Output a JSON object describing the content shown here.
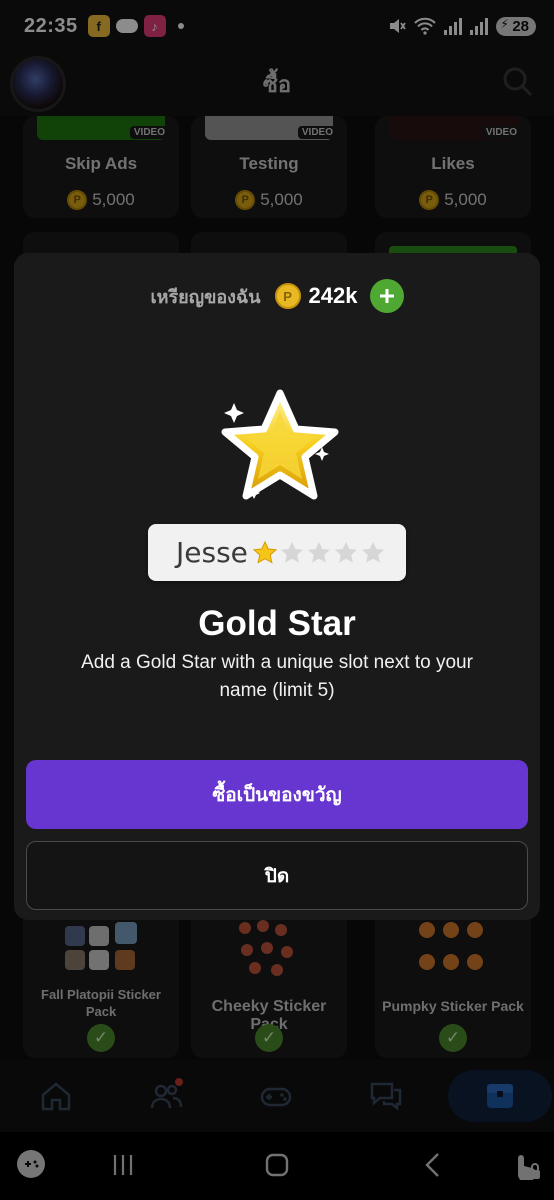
{
  "status_bar": {
    "time": "22:35",
    "battery": "28",
    "icons": [
      "f-app-icon",
      "cloud-icon",
      "music-app-icon",
      "dot-icon",
      "mute-icon",
      "wifi-icon",
      "signal-icon",
      "signal-icon",
      "battery-icon"
    ]
  },
  "header": {
    "title": "ซื้อ",
    "icons": [
      "avatar",
      "search-icon"
    ]
  },
  "background_cards": [
    {
      "label": "Skip Ads",
      "price": "5,000",
      "tag": "VIDEO"
    },
    {
      "label": "Testing",
      "price": "5,000",
      "tag": "VIDEO"
    },
    {
      "label": "Likes",
      "price": "5,000",
      "tag": "VIDEO"
    },
    {
      "label": "Fall Platopii Sticker Pack"
    },
    {
      "label": "Cheeky Sticker Pack"
    },
    {
      "label": "Pumpky Sticker Pack"
    }
  ],
  "modal": {
    "balance_label": "เหรียญของฉัน",
    "balance_value": "242k",
    "coin_symbol": "P",
    "plate_name": "Jesse",
    "item_title": "Gold Star",
    "item_description": "Add a Gold Star with a unique slot next to your name (limit 5)",
    "gift_button": "ซื้อเป็นของขวัญ",
    "close_button": "ปิด"
  },
  "bottom_nav": {
    "items": [
      "home-icon",
      "friends-icon",
      "games-icon",
      "chat-icon",
      "shop-icon"
    ],
    "active": "shop-icon"
  },
  "colors": {
    "accent_purple": "#6735cf",
    "add_green": "#4fa832",
    "coin_gold": "#e9b923",
    "modal_bg": "#1a1a1a"
  }
}
